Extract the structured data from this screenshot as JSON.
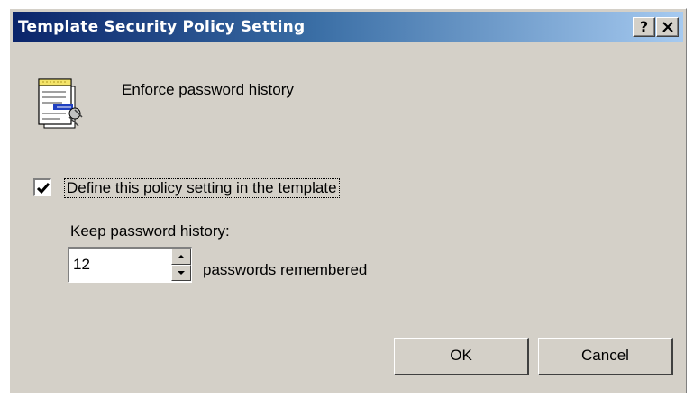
{
  "window": {
    "title": "Template Security Policy Setting",
    "help_button": "?",
    "close_button": "×"
  },
  "policy": {
    "icon": "policy-document-icon",
    "name": "Enforce password history"
  },
  "define": {
    "checked": true,
    "label": "Define this policy setting in the template"
  },
  "history": {
    "label": "Keep password history:",
    "value": "12",
    "suffix": "passwords remembered"
  },
  "buttons": {
    "ok": "OK",
    "cancel": "Cancel"
  },
  "colors": {
    "titlebar_start": "#0a246a",
    "titlebar_end": "#a6caf0",
    "face": "#d4d0c8"
  }
}
